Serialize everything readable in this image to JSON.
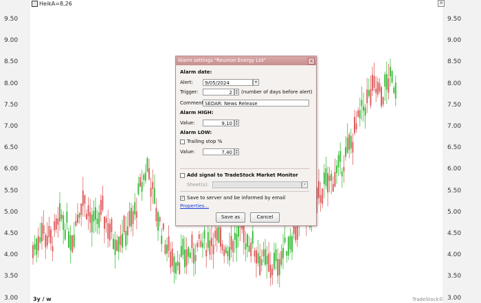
{
  "chart": {
    "title": "HeikA=8,26",
    "period_label": "3y / w",
    "brand": "TradeStock©",
    "close_glyph": "×",
    "y_ticks": [
      "9.50",
      "9.00",
      "8.50",
      "8.00",
      "7.50",
      "7.00",
      "6.50",
      "6.00",
      "5.50",
      "5.00",
      "4.50",
      "4.00",
      "3.50",
      "3.00"
    ],
    "ylim": [
      3.0,
      9.5
    ],
    "colors": {
      "up": "#3fbf3f",
      "down": "#e06060"
    }
  },
  "dialog": {
    "title": "Alarm settings \"Reunion Energy Ltd\"",
    "close_glyph": "×",
    "alarm_date_heading": "Alarm date:",
    "alert_label": "Alert:",
    "alert_value": "9/05/2024",
    "trigger_label": "Trigger:",
    "trigger_value": "2",
    "trigger_hint": "(number of days before alert)",
    "comment_label": "Comment:",
    "comment_value": "SEDAR: News Release",
    "alarm_high_heading": "Alarm HIGH:",
    "high_value_label": "Value:",
    "high_value": "9,10",
    "alarm_low_heading": "Alarm LOW:",
    "trailing_stop_label": "Trailing stop %",
    "low_value_label": "Value:",
    "low_value": "7,40",
    "market_monitor_label": "Add signal to TradeStock Market Monitor",
    "sheet_label": "Sheet(s):",
    "save_server_label": "Save to server and be informed by email",
    "check_mark": "✓",
    "properties_link": "Properties...",
    "save_button": "Save as",
    "cancel_button": "Cancel"
  }
}
